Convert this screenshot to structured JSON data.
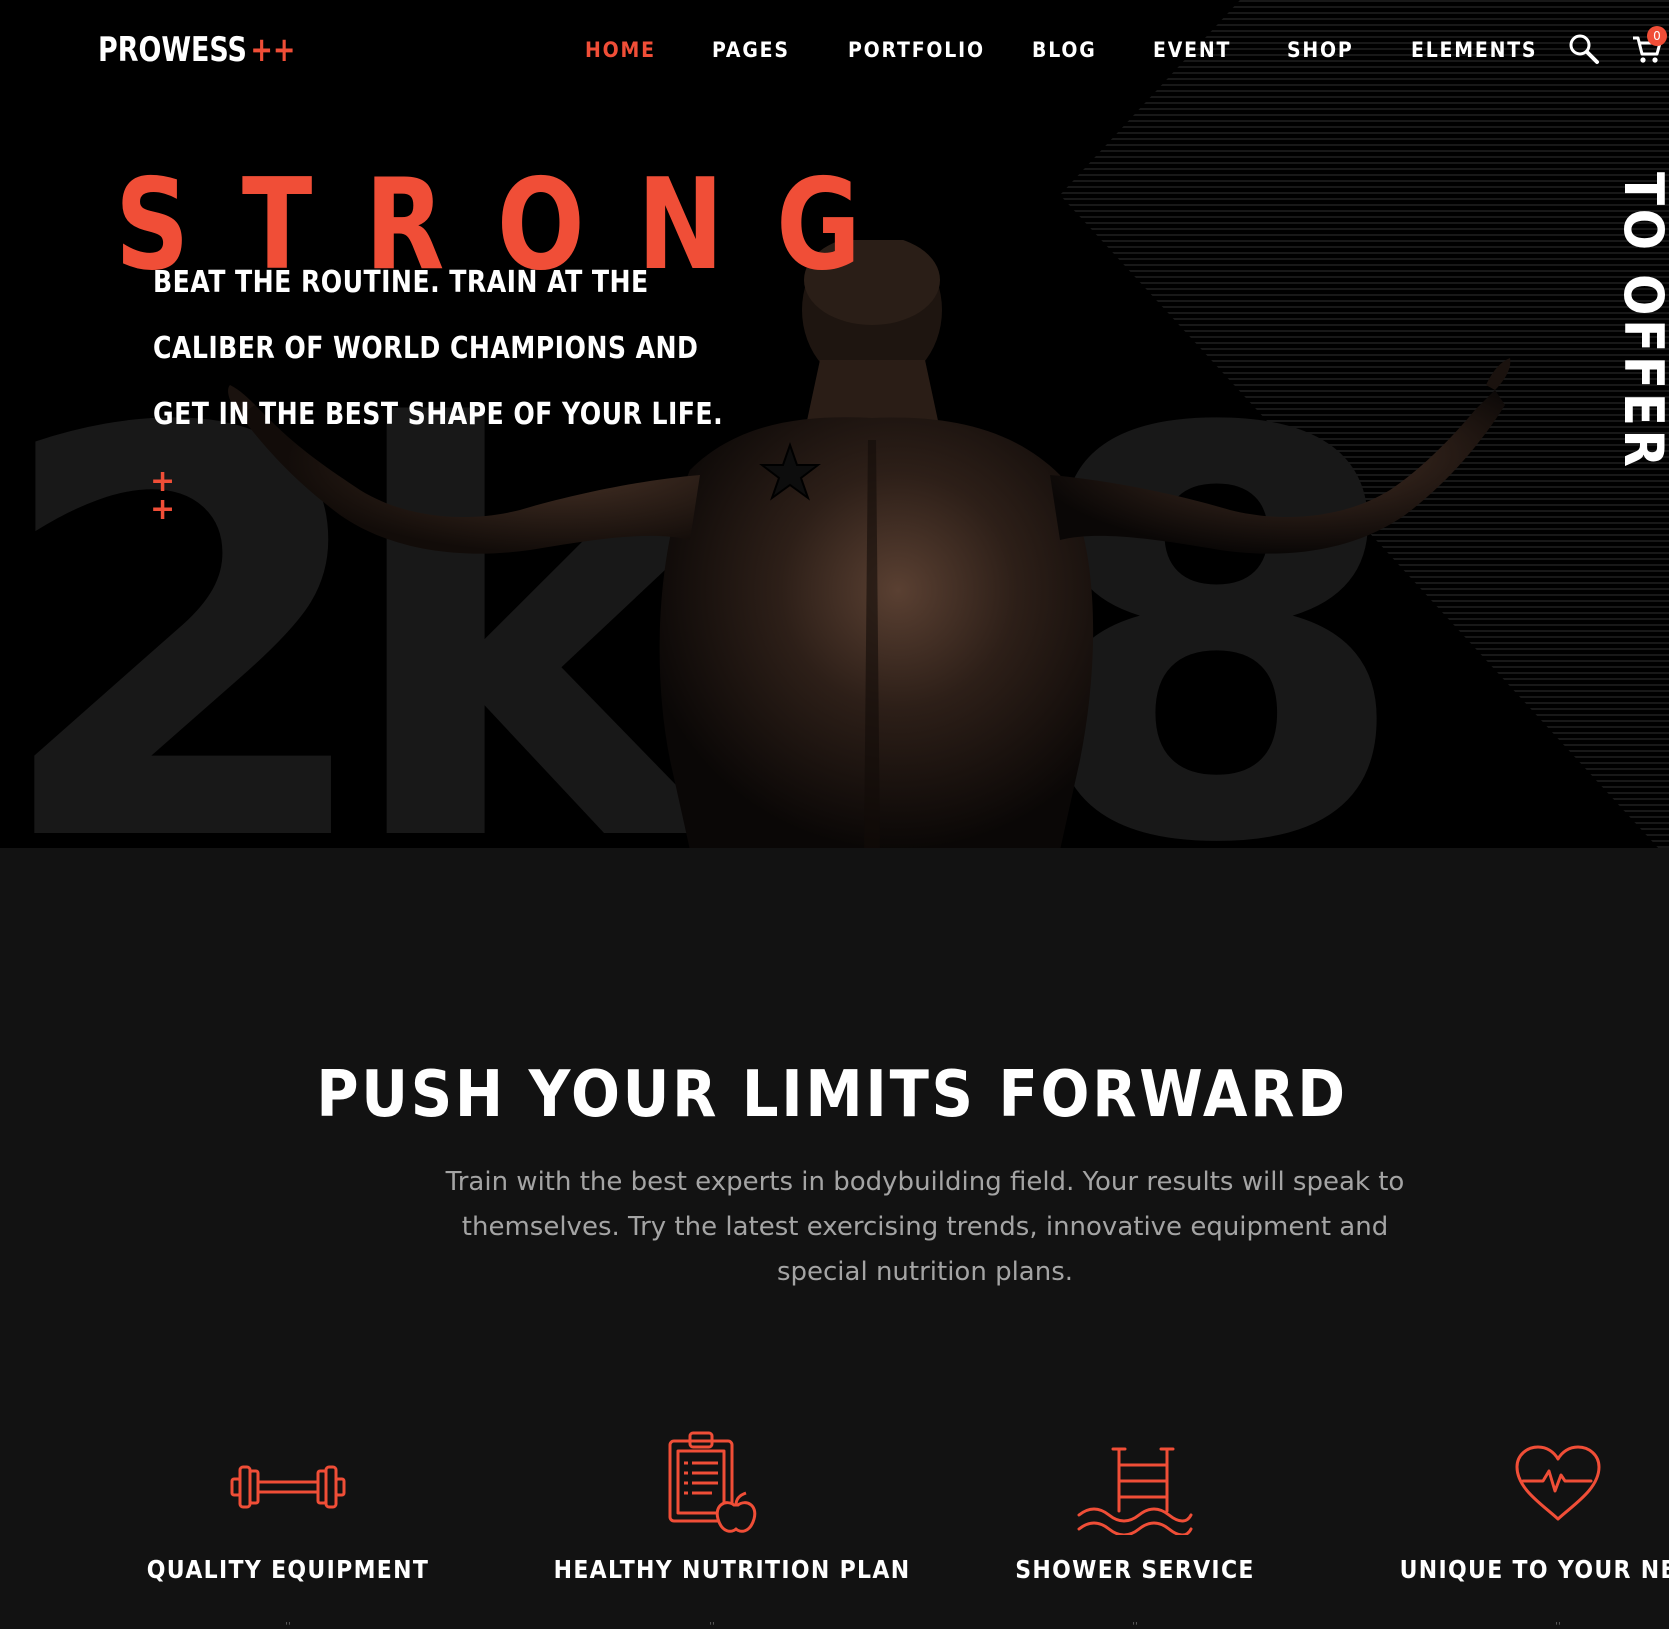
{
  "header": {
    "logo_text": "PROWESS",
    "logo_plus": "++",
    "nav": [
      {
        "label": "HOME",
        "active": true
      },
      {
        "label": "PAGES",
        "active": false
      },
      {
        "label": "PORTFOLIO",
        "active": false
      },
      {
        "label": "BLOG",
        "active": false
      },
      {
        "label": "EVENT",
        "active": false
      },
      {
        "label": "SHOP",
        "active": false
      },
      {
        "label": "ELEMENTS",
        "active": false
      }
    ],
    "search_icon": "search-icon",
    "cart_icon": "cart-icon",
    "cart_count": "0"
  },
  "hero": {
    "title": "STRONG",
    "copy_lines": [
      "BEAT THE ROUTINE. TRAIN AT THE",
      "CALIBER OF WORLD CHAMPIONS AND",
      "GET IN THE BEST SHAPE OF YOUR LIFE."
    ],
    "bg_text": "2k18",
    "vertical_text": "TO OFFER",
    "plus_marks": [
      "+",
      "+"
    ]
  },
  "intro": {
    "title": "PUSH YOUR LIMITS FORWARD",
    "text": "Train with the best experts in bodybuilding field. Your results will speak to themselves. Try the latest exercising trends, innovative equipment and special nutrition plans."
  },
  "features": [
    {
      "label": "QUALITY EQUIPMENT",
      "icon": "dumbbell-icon"
    },
    {
      "label": "HEALTHY NUTRITION PLAN",
      "icon": "clipboard-apple-icon"
    },
    {
      "label": "SHOWER SERVICE",
      "icon": "pool-ladder-icon"
    },
    {
      "label": "UNIQUE TO YOUR NEEDS",
      "icon": "heartbeat-icon"
    }
  ],
  "colors": {
    "accent": "#f04e37",
    "background": "#121212",
    "hero_background": "#000000",
    "text": "#ffffff",
    "muted_text": "#a4a4a4"
  }
}
